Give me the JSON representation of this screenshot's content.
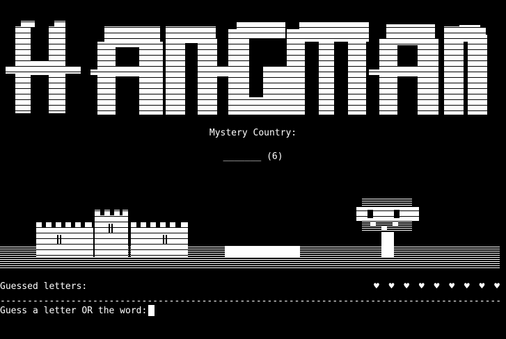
{
  "title_art": {
    "text": "HANGMAN"
  },
  "mystery": {
    "label": "Mystery Country:",
    "blanks": "_______",
    "length_hint": "(6)"
  },
  "guessed": {
    "label": "Guessed letters:",
    "value": ""
  },
  "lives": {
    "icon": "heart-icon",
    "count": 9,
    "display": "♥ ♥ ♥ ♥ ♥ ♥ ♥ ♥ ♥"
  },
  "divider": "--------------------------------------------------------------------------------------------",
  "prompt": {
    "label": "Guess a letter OR the word:"
  },
  "colors": {
    "background": "#000000",
    "foreground": "#ffffff"
  }
}
